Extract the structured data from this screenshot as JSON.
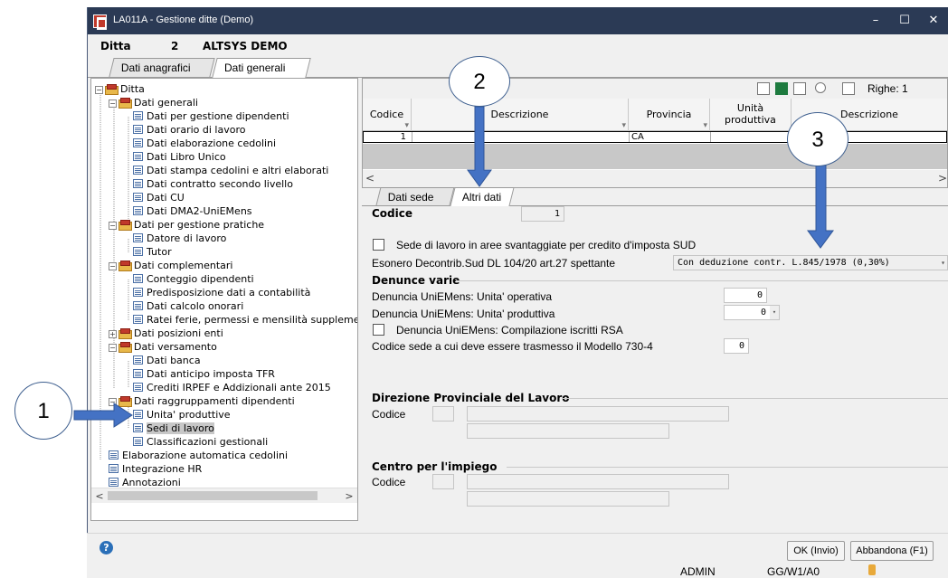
{
  "window": {
    "title": "LA011A - Gestione ditte (Demo)",
    "minimize": "–",
    "maximize": "☐",
    "close": "✕"
  },
  "ditta": {
    "label": "Ditta",
    "number": "2",
    "name": "ALTSYS DEMO"
  },
  "main_tabs": [
    {
      "label": "Dati anagrafici"
    },
    {
      "label": "Dati generali"
    }
  ],
  "tree": {
    "items": [
      {
        "label": "Ditta",
        "kind": "folder"
      },
      {
        "label": "Dati generali",
        "kind": "folder"
      },
      {
        "label": "Dati per gestione dipendenti",
        "kind": "doc"
      },
      {
        "label": "Dati orario di lavoro",
        "kind": "doc"
      },
      {
        "label": "Dati elaborazione cedolini",
        "kind": "doc"
      },
      {
        "label": "Dati Libro Unico",
        "kind": "doc"
      },
      {
        "label": "Dati stampa cedolini e altri elaborati",
        "kind": "doc"
      },
      {
        "label": "Dati contratto secondo livello",
        "kind": "doc"
      },
      {
        "label": "Dati CU",
        "kind": "doc"
      },
      {
        "label": "Dati DMA2-UniEMens",
        "kind": "doc"
      },
      {
        "label": "Dati per gestione pratiche",
        "kind": "folder"
      },
      {
        "label": "Datore di lavoro",
        "kind": "doc"
      },
      {
        "label": "Tutor",
        "kind": "doc"
      },
      {
        "label": "Dati complementari",
        "kind": "folder"
      },
      {
        "label": "Conteggio dipendenti",
        "kind": "doc"
      },
      {
        "label": "Predisposizione dati a contabilità",
        "kind": "doc"
      },
      {
        "label": "Dati calcolo onorari",
        "kind": "doc"
      },
      {
        "label": "Ratei ferie, permessi e mensilità suppleme",
        "kind": "doc"
      },
      {
        "label": "Dati posizioni enti",
        "kind": "folder"
      },
      {
        "label": "Dati versamento",
        "kind": "folder"
      },
      {
        "label": "Dati banca",
        "kind": "doc"
      },
      {
        "label": "Dati anticipo imposta TFR",
        "kind": "doc"
      },
      {
        "label": "Crediti IRPEF e Addizionali ante 2015",
        "kind": "doc"
      },
      {
        "label": "Dati raggruppamenti dipendenti",
        "kind": "folder"
      },
      {
        "label": "Unita' produttive",
        "kind": "doc"
      },
      {
        "label": "Sedi di lavoro",
        "kind": "doc"
      },
      {
        "label": "Classificazioni gestionali",
        "kind": "doc"
      },
      {
        "label": "Elaborazione automatica cedolini",
        "kind": "doc"
      },
      {
        "label": "Integrazione HR",
        "kind": "doc"
      },
      {
        "label": "Annotazioni",
        "kind": "doc"
      }
    ],
    "expand_minus": "−",
    "expand_plus": "+",
    "scroll_left": "<",
    "scroll_right": ">"
  },
  "grid": {
    "righe_label": "Righe: 1",
    "columns": [
      "Codice",
      "Descrizione",
      "Provincia",
      "Unità produttiva",
      "Descrizione"
    ],
    "unita_line1": "Unità",
    "unita_line2": "produttiva",
    "rows": [
      {
        "codice": "1",
        "descrizione": "",
        "provincia": "CA",
        "unita": "",
        "descrizione2": ""
      }
    ],
    "scroll_left": "<",
    "scroll_right": ">"
  },
  "sub_tabs": [
    {
      "label": "Dati sede"
    },
    {
      "label": "Altri dati"
    }
  ],
  "detail": {
    "codice_label": "Codice",
    "codice_value": "1",
    "sud_checkbox_label": "Sede di lavoro in aree svantaggiate per credito d'imposta SUD",
    "esonero_label": "Esonero Decontrib.Sud DL 104/20 art.27 spettante",
    "esonero_value": "Con deduzione contr. L.845/1978 (0,30%)",
    "denunce_title": "Denunce varie",
    "uniemens_operativa_label": "Denuncia UniEMens: Unita' operativa",
    "uniemens_operativa_value": "0",
    "uniemens_produttiva_label": "Denuncia UniEMens: Unita' produttiva",
    "uniemens_produttiva_value": "0",
    "rsa_checkbox_label": "Denuncia UniEMens: Compilazione iscritti RSA",
    "sede_730_label": "Codice sede a cui deve essere trasmesso il Modello 730-4",
    "sede_730_value": "0",
    "dpl_title": "Direzione Provinciale del Lavoro",
    "dpl_codice_label": "Codice",
    "cpi_title": "Centro per l'impiego",
    "cpi_codice_label": "Codice"
  },
  "footer": {
    "help": "?",
    "ok_label": "OK (Invio)",
    "cancel_label": "Abbandona (F1)",
    "user": "ADMIN",
    "session": "GG/W1/A0"
  },
  "callouts": [
    "1",
    "2",
    "3"
  ],
  "colors": {
    "titlebar": "#2b3a55",
    "arrow": "#4472c4",
    "callout_border": "#3e5f8f"
  }
}
